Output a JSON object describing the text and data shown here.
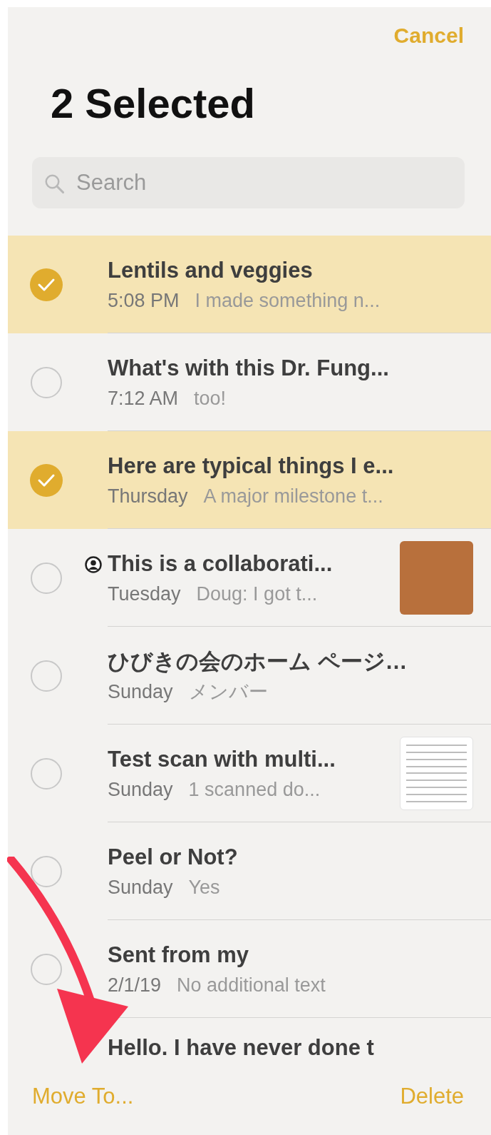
{
  "nav": {
    "cancel": "Cancel",
    "title": "2 Selected"
  },
  "search": {
    "placeholder": "Search"
  },
  "notes": [
    {
      "title": "Lentils and veggies",
      "date": "5:08 PM",
      "preview": "I made something n...",
      "selected": true,
      "shared": false
    },
    {
      "title": "What's with this Dr. Fung...",
      "date": "7:12 AM",
      "preview": "too!",
      "selected": false,
      "shared": false
    },
    {
      "title": "Here are typical things I e...",
      "date": "Thursday",
      "preview": "A major milestone t...",
      "selected": true,
      "shared": false
    },
    {
      "title": "This is a collaborati...",
      "date": "Tuesday",
      "preview": "Doug: I got t...",
      "selected": false,
      "shared": true,
      "kind": "photo"
    },
    {
      "title": "ひびきの会のホーム ページ…",
      "date": "Sunday",
      "preview": "メンバー",
      "selected": false,
      "shared": false
    },
    {
      "title": "Test scan with multi...",
      "date": "Sunday",
      "preview": "1 scanned do...",
      "selected": false,
      "shared": false,
      "kind": "document"
    },
    {
      "title": "Peel or Not?",
      "date": "Sunday",
      "preview": "Yes",
      "selected": false,
      "shared": false
    },
    {
      "title": "Sent from my",
      "date": "2/1/19",
      "preview": "No additional text",
      "selected": false,
      "shared": false
    },
    {
      "title": "Hello. I have never done t",
      "selected": false,
      "shared": false
    }
  ],
  "toolbar": {
    "move": "Move To...",
    "delete": "Delete"
  }
}
